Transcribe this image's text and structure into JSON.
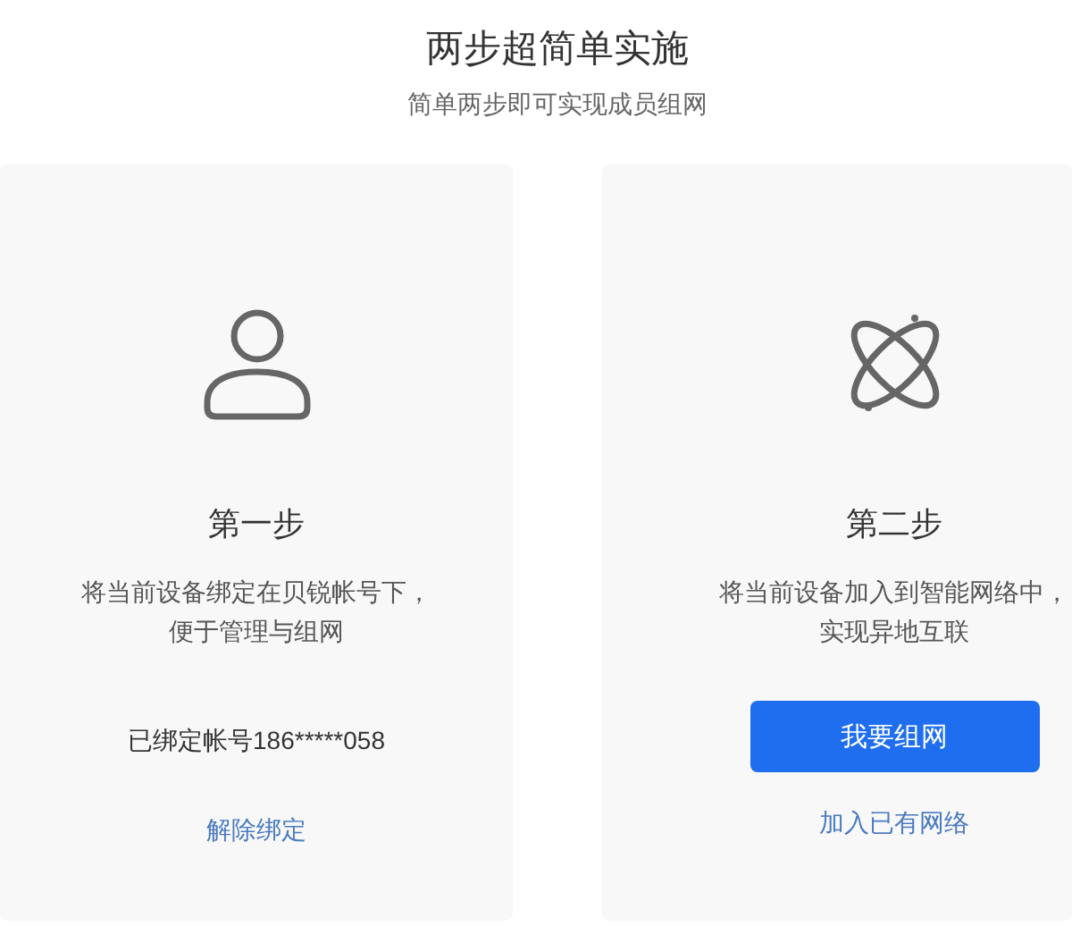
{
  "header": {
    "title": "两步超简单实施",
    "subtitle": "简单两步即可实现成员组网"
  },
  "steps": [
    {
      "kind": "person",
      "title": "第一步",
      "description": [
        "将当前设备绑定在贝锐帐号下，",
        "便于管理与组网"
      ],
      "account": "已绑定帐号186*****058",
      "actions": [
        {
          "kind": "link",
          "label": "解除绑定"
        }
      ]
    },
    {
      "kind": "orbit",
      "title": "第二步",
      "description": [
        "将当前设备加入到智能网络中，",
        "实现异地互联"
      ],
      "actions": [
        {
          "kind": "button",
          "label": "我要组网"
        },
        {
          "kind": "link",
          "label": "加入已有网络"
        }
      ]
    }
  ]
}
